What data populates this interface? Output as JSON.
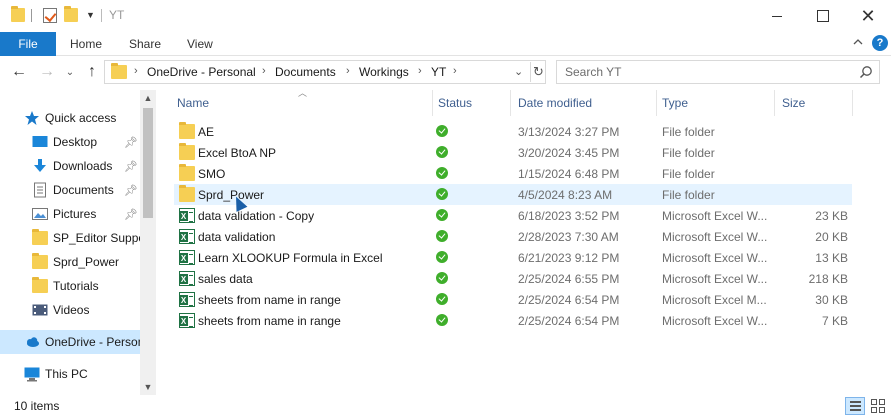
{
  "window": {
    "title": "YT"
  },
  "ribbon": {
    "tabs": [
      "File",
      "Home",
      "Share",
      "View"
    ]
  },
  "address": {
    "breadcrumbs": [
      "OneDrive - Personal",
      "Documents",
      "Workings",
      "YT"
    ]
  },
  "search": {
    "placeholder": "Search YT"
  },
  "nav": {
    "items": [
      {
        "label": "Quick access",
        "icon": "quick-access-star-icon",
        "pinned": false
      },
      {
        "label": "Desktop",
        "icon": "desktop-icon",
        "pinned": true
      },
      {
        "label": "Downloads",
        "icon": "downloads-icon",
        "pinned": true
      },
      {
        "label": "Documents",
        "icon": "documents-icon",
        "pinned": true
      },
      {
        "label": "Pictures",
        "icon": "pictures-icon",
        "pinned": true
      },
      {
        "label": "SP_Editor Suppo",
        "icon": "folder-icon",
        "pinned": false
      },
      {
        "label": "Sprd_Power",
        "icon": "folder-icon",
        "pinned": false
      },
      {
        "label": "Tutorials",
        "icon": "folder-icon",
        "pinned": false
      },
      {
        "label": "Videos",
        "icon": "videos-icon",
        "pinned": false
      },
      {
        "label": "OneDrive - Person",
        "icon": "onedrive-cloud-icon",
        "pinned": false
      },
      {
        "label": "This PC",
        "icon": "this-pc-icon",
        "pinned": false
      }
    ]
  },
  "columns": {
    "name": "Name",
    "status": "Status",
    "date": "Date modified",
    "type": "Type",
    "size": "Size"
  },
  "files": [
    {
      "name": "AE",
      "date": "3/13/2024 3:27 PM",
      "type": "File folder",
      "size": "",
      "kind": "folder"
    },
    {
      "name": "Excel BtoA NP",
      "date": "3/20/2024 3:45 PM",
      "type": "File folder",
      "size": "",
      "kind": "folder"
    },
    {
      "name": "SMO",
      "date": "1/15/2024 6:48 PM",
      "type": "File folder",
      "size": "",
      "kind": "folder"
    },
    {
      "name": "Sprd_Power",
      "date": "4/5/2024 8:23 AM",
      "type": "File folder",
      "size": "",
      "kind": "folder"
    },
    {
      "name": "data validation - Copy",
      "date": "6/18/2023 3:52 PM",
      "type": "Microsoft Excel W...",
      "size": "23 KB",
      "kind": "excel"
    },
    {
      "name": "data validation",
      "date": "2/28/2023 7:30 AM",
      "type": "Microsoft Excel W...",
      "size": "20 KB",
      "kind": "excel"
    },
    {
      "name": "Learn XLOOKUP Formula in Excel",
      "date": "6/21/2023 9:12 PM",
      "type": "Microsoft Excel W...",
      "size": "13 KB",
      "kind": "excel"
    },
    {
      "name": "sales data",
      "date": "2/25/2024 6:55 PM",
      "type": "Microsoft Excel W...",
      "size": "218 KB",
      "kind": "excel"
    },
    {
      "name": "sheets from name in range",
      "date": "2/25/2024 6:54 PM",
      "type": "Microsoft Excel M...",
      "size": "30 KB",
      "kind": "excel"
    },
    {
      "name": "sheets from name in range",
      "date": "2/25/2024 6:54 PM",
      "type": "Microsoft Excel W...",
      "size": "7 KB",
      "kind": "excel"
    }
  ],
  "statusbar": {
    "count": "10 items"
  },
  "colors": {
    "accent": "#1979ca",
    "selection": "#cce8ff",
    "hover": "#e5f3ff",
    "folder": "#f6cf54",
    "excel": "#1f7244",
    "sync_ok": "#3fae2b"
  }
}
